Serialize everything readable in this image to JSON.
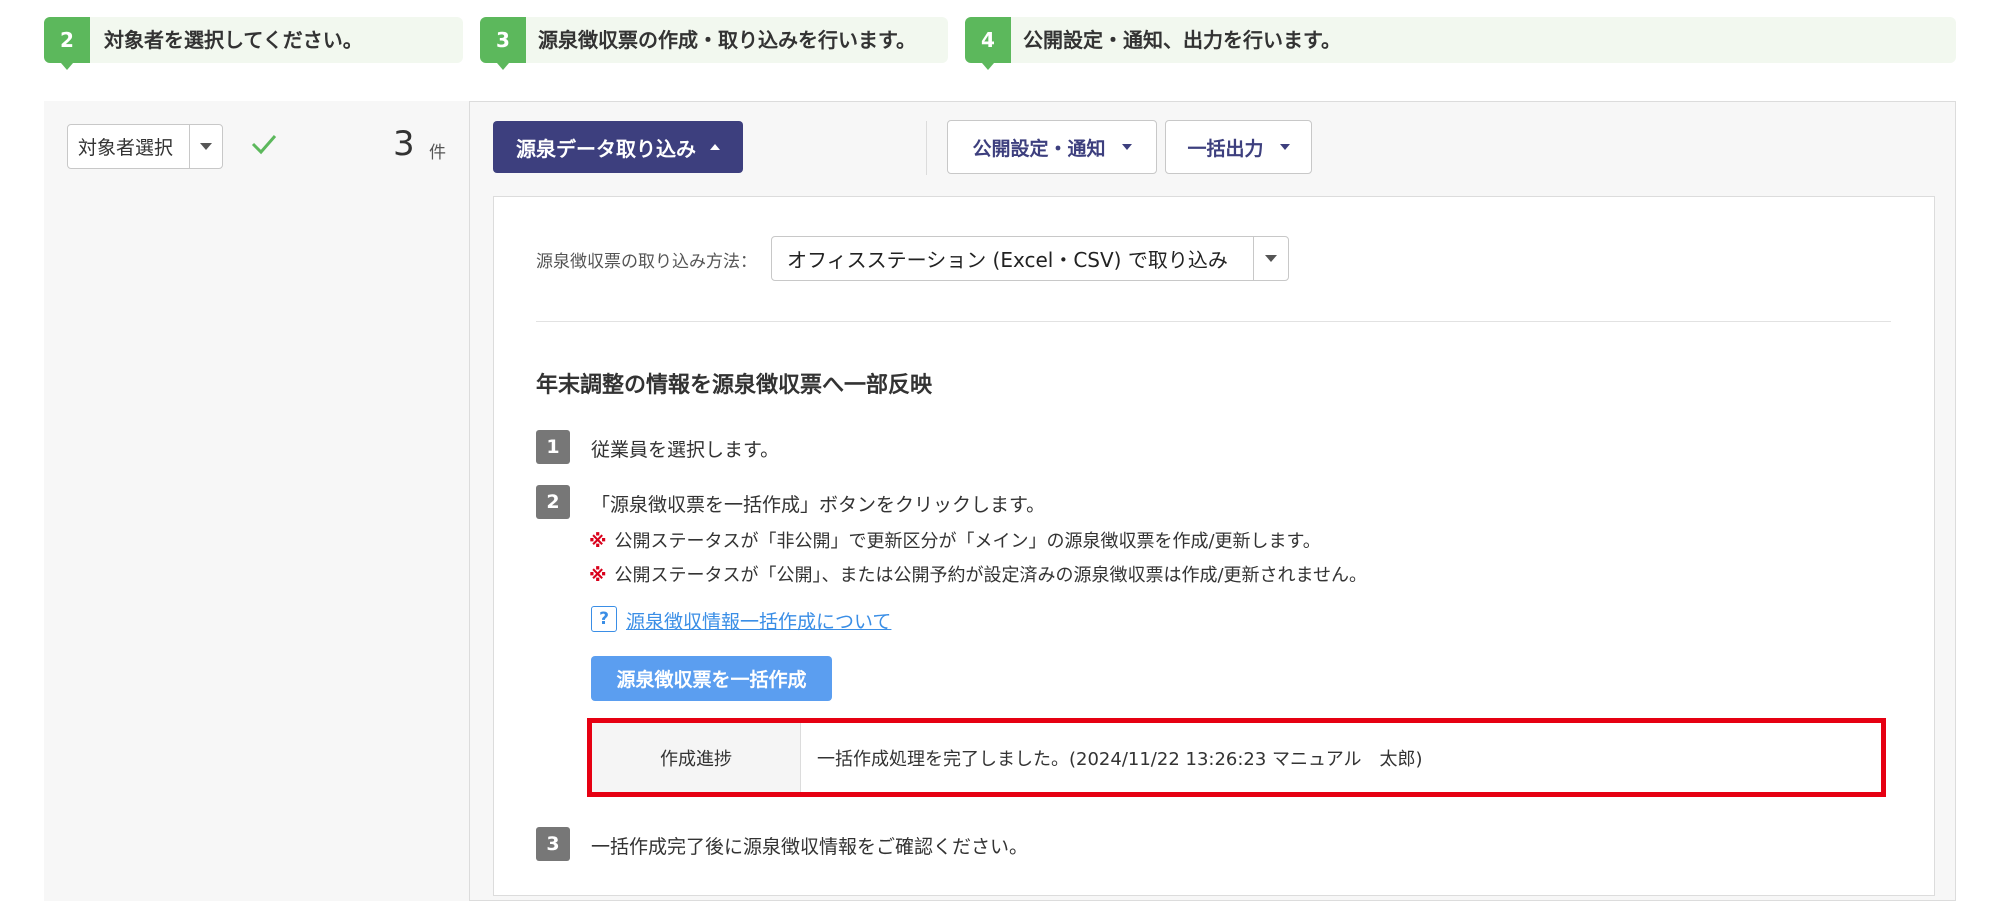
{
  "steps": [
    {
      "number": "2",
      "text": "対象者を選択してください。"
    },
    {
      "number": "3",
      "text": "源泉徴収票の作成・取り込みを行います。"
    },
    {
      "number": "4",
      "text": "公開設定・通知、出力を行います。"
    }
  ],
  "left_panel": {
    "target_select_value": "対象者選択",
    "count_value": "3",
    "count_unit": "件"
  },
  "toolbar": {
    "import_button_label": "源泉データ取り込み",
    "publish_button_label": "公開設定・通知",
    "bulk_output_button_label": "一括出力"
  },
  "import_method": {
    "label": "源泉徴収票の取り込み方法：",
    "selected": "オフィスステーション (Excel・CSV) で取り込み"
  },
  "section": {
    "title": "年末調整の情報を源泉徴収票へ一部反映",
    "step1": {
      "number": "1",
      "text": "従業員を選択します。"
    },
    "step2": {
      "number": "2",
      "text": "「源泉徴収票を一括作成」ボタンをクリックします。",
      "note_mark": "※",
      "note1": "公開ステータスが「非公開」で更新区分が「メイン」の源泉徴収票を作成/更新します。",
      "note2": "公開ステータスが「公開」、または公開予約が設定済みの源泉徴収票は作成/更新されません。"
    },
    "help_icon_glyph": "?",
    "help_link": "源泉徴収情報一括作成について",
    "create_button_label": "源泉徴収票を一括作成",
    "progress_label": "作成進捗",
    "progress_value": "一括作成処理を完了しました。(2024/11/22 13:26:23 マニュアル　太郎)",
    "step3": {
      "number": "3",
      "text": "一括作成完了後に源泉徴収情報をご確認ください。"
    }
  },
  "colors": {
    "step_green": "#5cb85c",
    "navy": "#3d3f7e",
    "primary_blue": "#5b9ef0",
    "highlight_red": "#e60012",
    "check_green": "#5cb85c",
    "link_blue": "#3a8ee6"
  },
  "icons": {
    "check": "check-icon",
    "help": "help-icon",
    "caret": "chevron-down-icon"
  }
}
